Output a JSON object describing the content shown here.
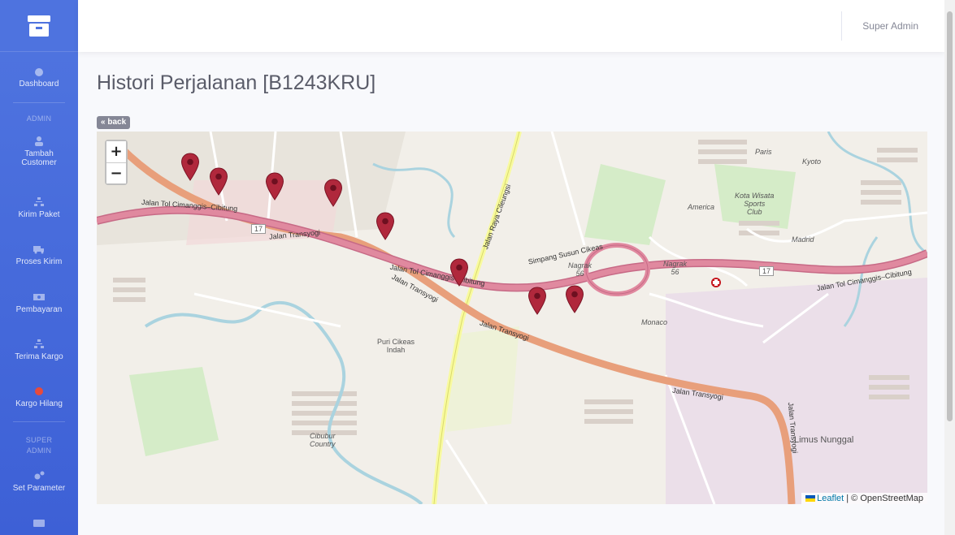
{
  "sidebar": {
    "items": [
      {
        "label": "Dashboard",
        "icon": "dashboard-icon"
      },
      {
        "label": "Tambah Customer",
        "icon": "user-icon"
      },
      {
        "label": "Kirim Paket",
        "icon": "sitemap-icon"
      },
      {
        "label": "Proses Kirim",
        "icon": "truck-icon"
      },
      {
        "label": "Pembayaran",
        "icon": "money-icon"
      },
      {
        "label": "Terima Kargo",
        "icon": "sitemap-icon"
      },
      {
        "label": "Kargo Hilang",
        "icon": "alert-dot-icon"
      },
      {
        "label": "Set Parameter",
        "icon": "gears-icon"
      }
    ],
    "headings": {
      "admin": "ADMIN",
      "super_admin": "SUPER ADMIN"
    }
  },
  "topbar": {
    "user": "Super Admin"
  },
  "page": {
    "title": "Histori Perjalanan [B1243KRU]",
    "back_label": "« back"
  },
  "map": {
    "zoom_in": "+",
    "zoom_out": "−",
    "attribution_leaflet": "Leaflet",
    "attribution_rest": " | © OpenStreetMap",
    "labels": {
      "tol1": "Jalan Tol Cimanggis–Cibitung",
      "tol2": "Jalan Tol Cimanggis–Cibitung",
      "tol3": "Jalan Tol Cimanggis–Cibitung",
      "transyogi1": "Jalan Transyogi",
      "transyogi2": "Jalan Transyogi",
      "transyogi3": "Jalan Transyogi",
      "transyogi4": "Jalan Transyogi",
      "transyogi5": "Jalan Transyogi",
      "puri": "Puri Cikeas\nIndah",
      "cibubur": "Cibubur\nCountry",
      "limus": "Limus Nunggal",
      "kota_wisata": "Kota Wisata\nSports\nClub",
      "america": "America",
      "nagrak1": "Nagrak\n56",
      "nagrak2": "Nagrak\n56",
      "simpang": "Simpang Susun Cikeas",
      "raya": "Jalan Raya Cileungsi",
      "madrid": "Madrid",
      "kyoto": "Kyoto",
      "paris": "Paris",
      "monaco": "Monaco",
      "shield17a": "17",
      "shield17b": "17"
    },
    "marker_color": "#b0283c",
    "marker_count": 8
  }
}
